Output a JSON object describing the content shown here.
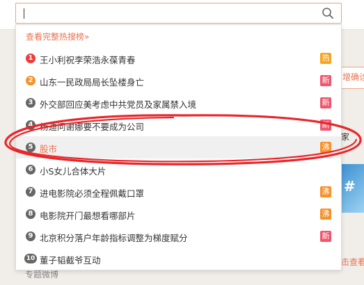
{
  "background": {
    "right_card_text": "增确诊",
    "right_text": "家",
    "right_img_text": "#",
    "right_link": "击查看",
    "bottom_link": "专题微博"
  },
  "search": {
    "value": "",
    "icon": "search-icon"
  },
  "dropdown": {
    "more_link": "查看完整热搜榜»",
    "rows": [
      {
        "rank": "1",
        "text": "王小利祝李荣浩永葆青春",
        "badge": "热",
        "badge_type": "hot"
      },
      {
        "rank": "2",
        "text": "山东一民政局局长坠楼身亡",
        "badge": "新",
        "badge_type": "new"
      },
      {
        "rank": "3",
        "text": "外交部回应美考虑中共党员及家属禁入境",
        "badge": "新",
        "badge_type": "new"
      },
      {
        "rank": "4",
        "text": "杨迪问谢娜要不要成为公司",
        "badge": "新",
        "badge_type": "new"
      },
      {
        "rank": "5",
        "text": "股市",
        "badge": "沸",
        "badge_type": "boil",
        "active": true
      },
      {
        "rank": "6",
        "text": "小S女儿合体大片",
        "badge": "",
        "badge_type": ""
      },
      {
        "rank": "7",
        "text": "进电影院必须全程佩戴口罩",
        "badge": "沸",
        "badge_type": "boil"
      },
      {
        "rank": "8",
        "text": "电影院开门最想看哪部片",
        "badge": "沸",
        "badge_type": "boil"
      },
      {
        "rank": "9",
        "text": "北京积分落户年龄指标调整为梯度赋分",
        "badge": "新",
        "badge_type": "new"
      },
      {
        "rank": "10",
        "text": "董子韬截爷互动",
        "badge": "",
        "badge_type": ""
      }
    ]
  },
  "colors": {
    "accent": "#eb7350",
    "annotation_red": "#e8262a"
  }
}
